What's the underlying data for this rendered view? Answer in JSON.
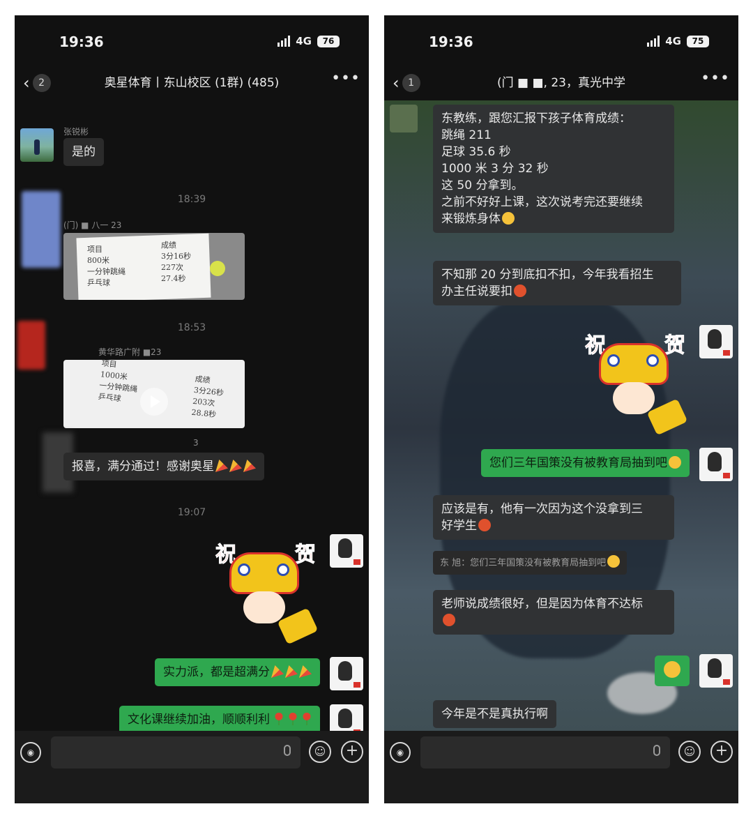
{
  "left": {
    "status": {
      "time": "19:36",
      "network": "4G",
      "battery": "76"
    },
    "header": {
      "back_count": "2",
      "title": "奥星体育丨东山校区 (1群) (485)"
    },
    "messages": {
      "m1_sender": "张锐彬",
      "m1_text": "是的",
      "ts1": "18:39",
      "m2_sender": "(门)      ■  八一 23",
      "photo1": {
        "col1": "项目\n800米\n一分钟跳绳\n乒乓球",
        "col2": "成绩\n3分16秒\n227次\n27.4秒"
      },
      "ts2": "18:53",
      "m3_sender": "黄华路广附       ■23",
      "video1": {
        "col1": "项目\n1000米\n一分钟跳绳\n乒乓球",
        "col2": "成绩\n3分26秒\n203次\n28.8秒"
      },
      "m4_sender": "3",
      "m4_text": "报喜，满分通过！感谢奥星",
      "ts3": "19:07",
      "sticker_chars": [
        "祝",
        "贺"
      ],
      "out1": "实力派，都是超满分",
      "out2": "文化课继续加油，顺顺利利"
    }
  },
  "right": {
    "status": {
      "time": "19:36",
      "network": "4G",
      "battery": "75"
    },
    "header": {
      "back_count": "1",
      "title": "(门   ■  ■, 23，真光中学"
    },
    "messages": {
      "in1": "东教练，跟您汇报下孩子体育成绩：\n跳绳 211\n足球 35.6 秒\n1000 米 3 分 32 秒\n这 50 分拿到。\n之前不好好上课，这次说考完还要继续\n来锻炼身体",
      "in2": "不知那 20 分到底扣不扣，今年我看招生\n办主任说要扣",
      "sticker_chars": [
        "祝",
        "贺"
      ],
      "out1": "您们三年国策没有被教育局抽到吧",
      "in3": "应该是有，他有一次因为这个没拿到三\n好学生",
      "quote": "东  旭：您们三年国策没有被教育局抽到吧",
      "in4": "老师说成绩很好，但是因为体育不达标",
      "in5": "今年是不是真执行啊"
    }
  }
}
